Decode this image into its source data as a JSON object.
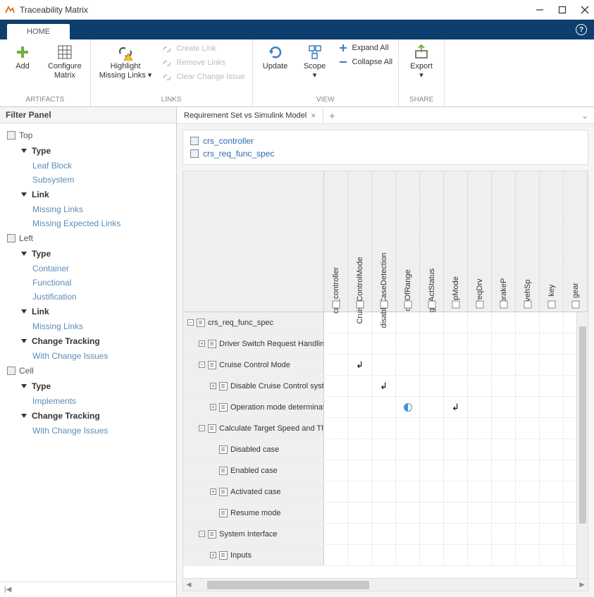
{
  "window": {
    "title": "Traceability Matrix",
    "tab": "HOME"
  },
  "ribbon": {
    "add": "Add",
    "configure": "Configure\nMatrix",
    "highlight": "Highlight\nMissing Links",
    "create_link": "Create Link",
    "remove_links": "Remove Links",
    "clear_change": "Clear Change Issue",
    "update": "Update",
    "scope": "Scope",
    "expand_all": "Expand All",
    "collapse_all": "Collapse All",
    "export": "Export",
    "g_artifacts": "ARTIFACTS",
    "g_links": "LINKS",
    "g_view": "VIEW",
    "g_share": "SHARE"
  },
  "filter": {
    "title": "Filter Panel",
    "top": "Top",
    "type": "Type",
    "leaf_block": "Leaf Block",
    "subsystem": "Subsystem",
    "link": "Link",
    "missing_links": "Missing Links",
    "missing_expected": "Missing Expected Links",
    "left": "Left",
    "container": "Container",
    "functional": "Functional",
    "justification": "Justification",
    "change_tracking": "Change Tracking",
    "with_change_issues": "With Change Issues",
    "cell": "Cell",
    "implements": "Implements"
  },
  "doc": {
    "tab_label": "Requirement Set vs Simulink Model",
    "link1": "crs_controller",
    "link2": "crs_req_func_spec"
  },
  "columns": [
    "crs_controller",
    "CruiseControlMode",
    "disableCaseDetection",
    "outOfRange",
    "getActStatus",
    "opMode",
    "reqDrv",
    "brakeP",
    "vehSp",
    "key",
    "gear"
  ],
  "rows": [
    {
      "indent": 0,
      "exp": "-",
      "label": "crs_req_func_spec"
    },
    {
      "indent": 1,
      "exp": "+",
      "label": "Driver Switch Request Handling"
    },
    {
      "indent": 1,
      "exp": "-",
      "label": "Cruise Control Mode"
    },
    {
      "indent": 2,
      "exp": "+",
      "label": "Disable Cruise Control system"
    },
    {
      "indent": 2,
      "exp": "+",
      "label": "Operation mode determination"
    },
    {
      "indent": 1,
      "exp": "-",
      "label": "Calculate Target Speed and Throttle"
    },
    {
      "indent": 2,
      "exp": "",
      "label": "Disabled case"
    },
    {
      "indent": 2,
      "exp": "",
      "label": "Enabled case"
    },
    {
      "indent": 2,
      "exp": "+",
      "label": "Activated case"
    },
    {
      "indent": 2,
      "exp": "",
      "label": "Resume mode"
    },
    {
      "indent": 1,
      "exp": "-",
      "label": "System Interface"
    },
    {
      "indent": 2,
      "exp": "+",
      "label": "Inputs"
    }
  ],
  "marks": {
    "2": {
      "1": "arrow"
    },
    "3": {
      "2": "arrow"
    },
    "4": {
      "3": "circle",
      "5": "arrow"
    }
  }
}
